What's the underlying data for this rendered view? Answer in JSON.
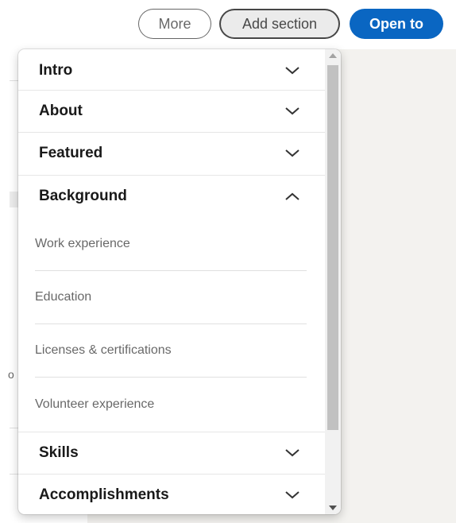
{
  "toolbar": {
    "more_label": "More",
    "add_section_label": "Add section",
    "open_to_label": "Open to"
  },
  "dropdown": {
    "sections": [
      {
        "label": "Intro",
        "expanded": false,
        "icon": "chevron-down-icon"
      },
      {
        "label": "About",
        "expanded": false,
        "icon": "chevron-down-icon"
      },
      {
        "label": "Featured",
        "expanded": false,
        "icon": "chevron-down-icon"
      },
      {
        "label": "Background",
        "expanded": true,
        "icon": "chevron-up-icon"
      },
      {
        "label": "Skills",
        "expanded": false,
        "icon": "chevron-down-icon"
      },
      {
        "label": "Accomplishments",
        "expanded": false,
        "icon": "chevron-down-icon"
      }
    ],
    "background_items": [
      "Work experience",
      "Education",
      "Licenses & certifications",
      "Volunteer experience"
    ]
  },
  "colors": {
    "primary_blue": "#0a66c2",
    "page_background": "#f3f2ef",
    "scrollbar_thumb": "#c1c1c1"
  }
}
